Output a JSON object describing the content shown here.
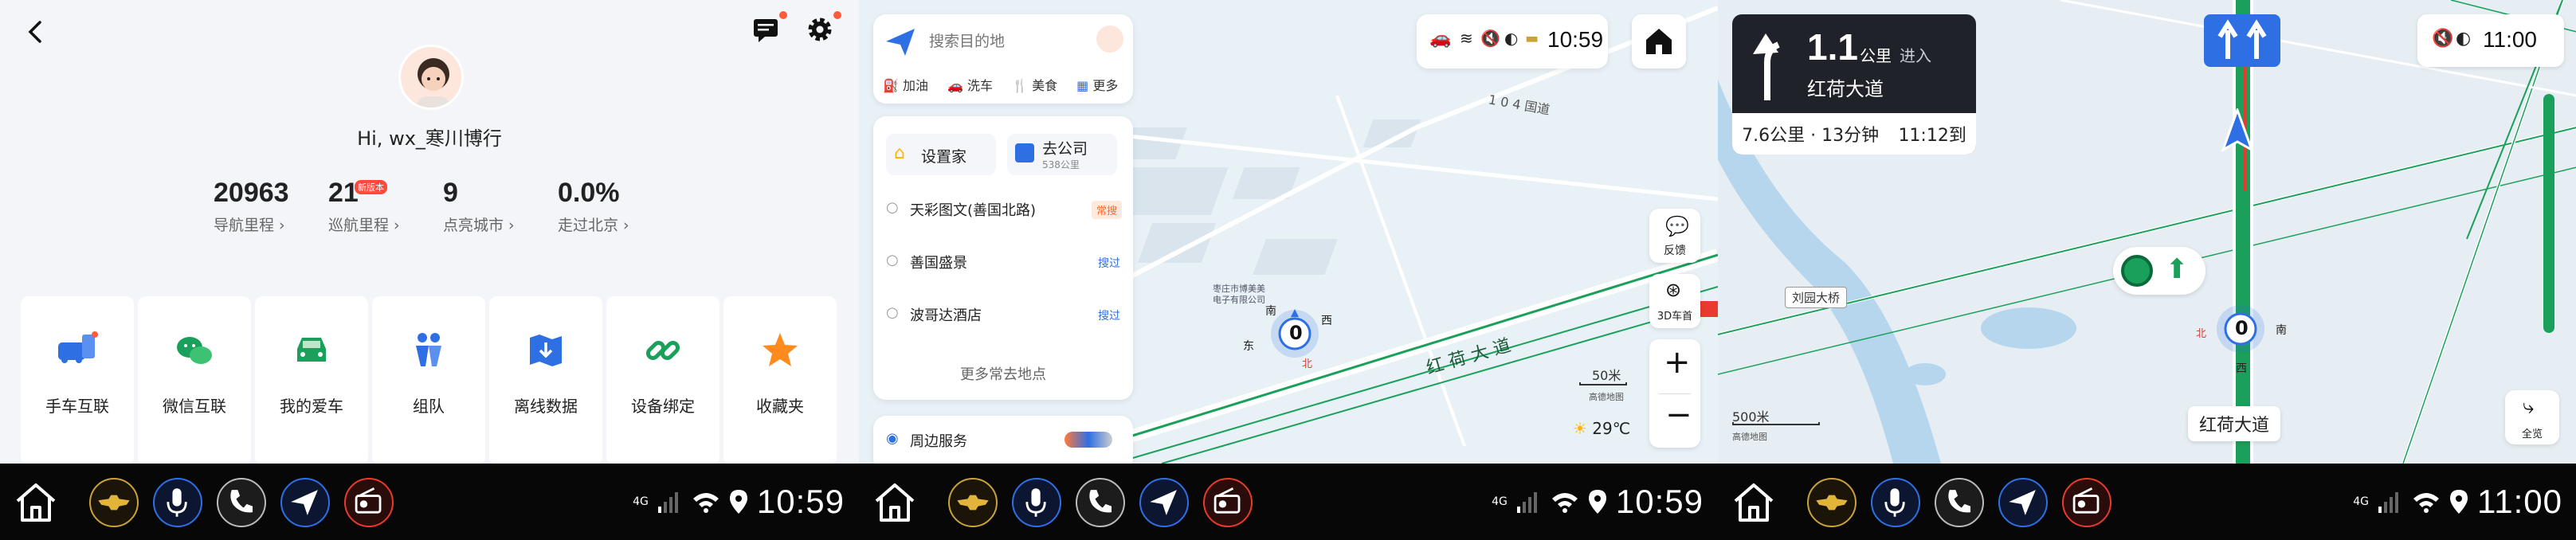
{
  "colors": {
    "accent": "#2f6fe4",
    "green": "#1aa05a",
    "red": "#e83a2e",
    "dock": "#070707"
  },
  "profile": {
    "greeting": "Hi, wx_寒川博行",
    "stats": [
      {
        "value": "20963",
        "label": "导航里程 ›"
      },
      {
        "value": "21",
        "badge": "新版本",
        "label": "巡航里程 ›"
      },
      {
        "value": "9",
        "label": "点亮城市 ›"
      },
      {
        "value": "0.0%",
        "label": "走过北京 ›"
      }
    ],
    "cards": [
      {
        "label": "手车互联",
        "icon": "car-phone-icon"
      },
      {
        "label": "微信互联",
        "icon": "wechat-icon"
      },
      {
        "label": "我的爱车",
        "icon": "car-icon"
      },
      {
        "label": "组队",
        "icon": "team-icon"
      },
      {
        "label": "离线数据",
        "icon": "offline-map-icon"
      },
      {
        "label": "设备绑定",
        "icon": "link-icon"
      },
      {
        "label": "收藏夹",
        "icon": "star-icon"
      }
    ]
  },
  "search": {
    "placeholder": "搜索目的地",
    "chips": [
      "加油",
      "洗车",
      "美食",
      "更多"
    ],
    "home": "设置家",
    "work": "去公司",
    "work_dist": "538公里",
    "history": [
      {
        "name": "天彩图文(善国北路)",
        "tag": "常搜"
      },
      {
        "name": "善国盛景",
        "tag": "搜过"
      },
      {
        "name": "波哥达酒店",
        "tag": "搜过"
      }
    ],
    "more": "更多常去地点",
    "nearby": "周边服务"
  },
  "map1": {
    "time": "10:59",
    "road_104": "1 0 4 国道",
    "road_main": "红 荷 大 道",
    "poi": "枣庄市博美美\n电子有限公司",
    "compass": {
      "speed": "0",
      "n": "北",
      "s": "南",
      "e": "东",
      "w": "西"
    },
    "feedback": "反馈",
    "mode": "3D车首",
    "scale": "50米",
    "scale_sub": "高德地图",
    "weather": "29℃"
  },
  "nav": {
    "distance": "1.1",
    "unit": "公里",
    "enter": "进入",
    "road": "红荷大道",
    "remain": "7.6公里 · 13分钟",
    "eta": "11:12到",
    "time": "11:00",
    "bridge": "刘园大桥",
    "current_road": "红荷大道",
    "compass": {
      "speed": "0",
      "n": "北",
      "s": "南",
      "w": "西"
    },
    "scale": "500米",
    "scale_sub": "高德地图",
    "overview": "全览"
  },
  "dock": {
    "time1": "10:59",
    "time2": "10:59",
    "time3": "11:00",
    "network": "4G"
  }
}
